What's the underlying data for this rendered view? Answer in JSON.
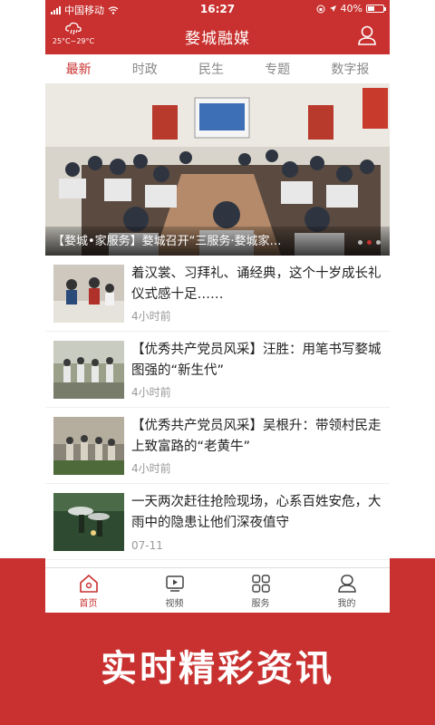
{
  "status_bar": {
    "carrier": "中国移动",
    "time": "16:27",
    "battery": "40%"
  },
  "header": {
    "title": "婺城融媒",
    "weather_temp": "25°C~29°C"
  },
  "tabs": [
    {
      "label": "最新",
      "active": true
    },
    {
      "label": "时政",
      "active": false
    },
    {
      "label": "民生",
      "active": false
    },
    {
      "label": "专题",
      "active": false
    },
    {
      "label": "数字报",
      "active": false
    }
  ],
  "banner": {
    "caption": "【婺城•家服务】婺城召开“三服务·婺城家…",
    "slide_count": 3,
    "active_slide": 2
  },
  "news": [
    {
      "title": "着汉裳、习拜礼、诵经典，这个十岁成长礼仪式感十足……",
      "time": "4小时前"
    },
    {
      "title": "【优秀共产党员风采】汪胜：用笔书写婺城图强的“新生代”",
      "time": "4小时前"
    },
    {
      "title": "【优秀共产党员风采】吴根升：带领村民走上致富路的“老黄牛”",
      "time": "4小时前"
    },
    {
      "title": "一天两次赶往抢险现场，心系百姓安危，大雨中的隐患让他们深夜值守",
      "time": "07-11"
    }
  ],
  "bottom_nav": [
    {
      "label": "首页",
      "icon": "home-icon",
      "active": true
    },
    {
      "label": "视频",
      "icon": "video-icon",
      "active": false
    },
    {
      "label": "服务",
      "icon": "grid-icon",
      "active": false
    },
    {
      "label": "我的",
      "icon": "user-icon",
      "active": false
    }
  ],
  "slogan": "实时精彩资讯",
  "colors": {
    "brand_red": "#c8312f",
    "tab_inactive": "#888888",
    "time_gray": "#999999"
  }
}
